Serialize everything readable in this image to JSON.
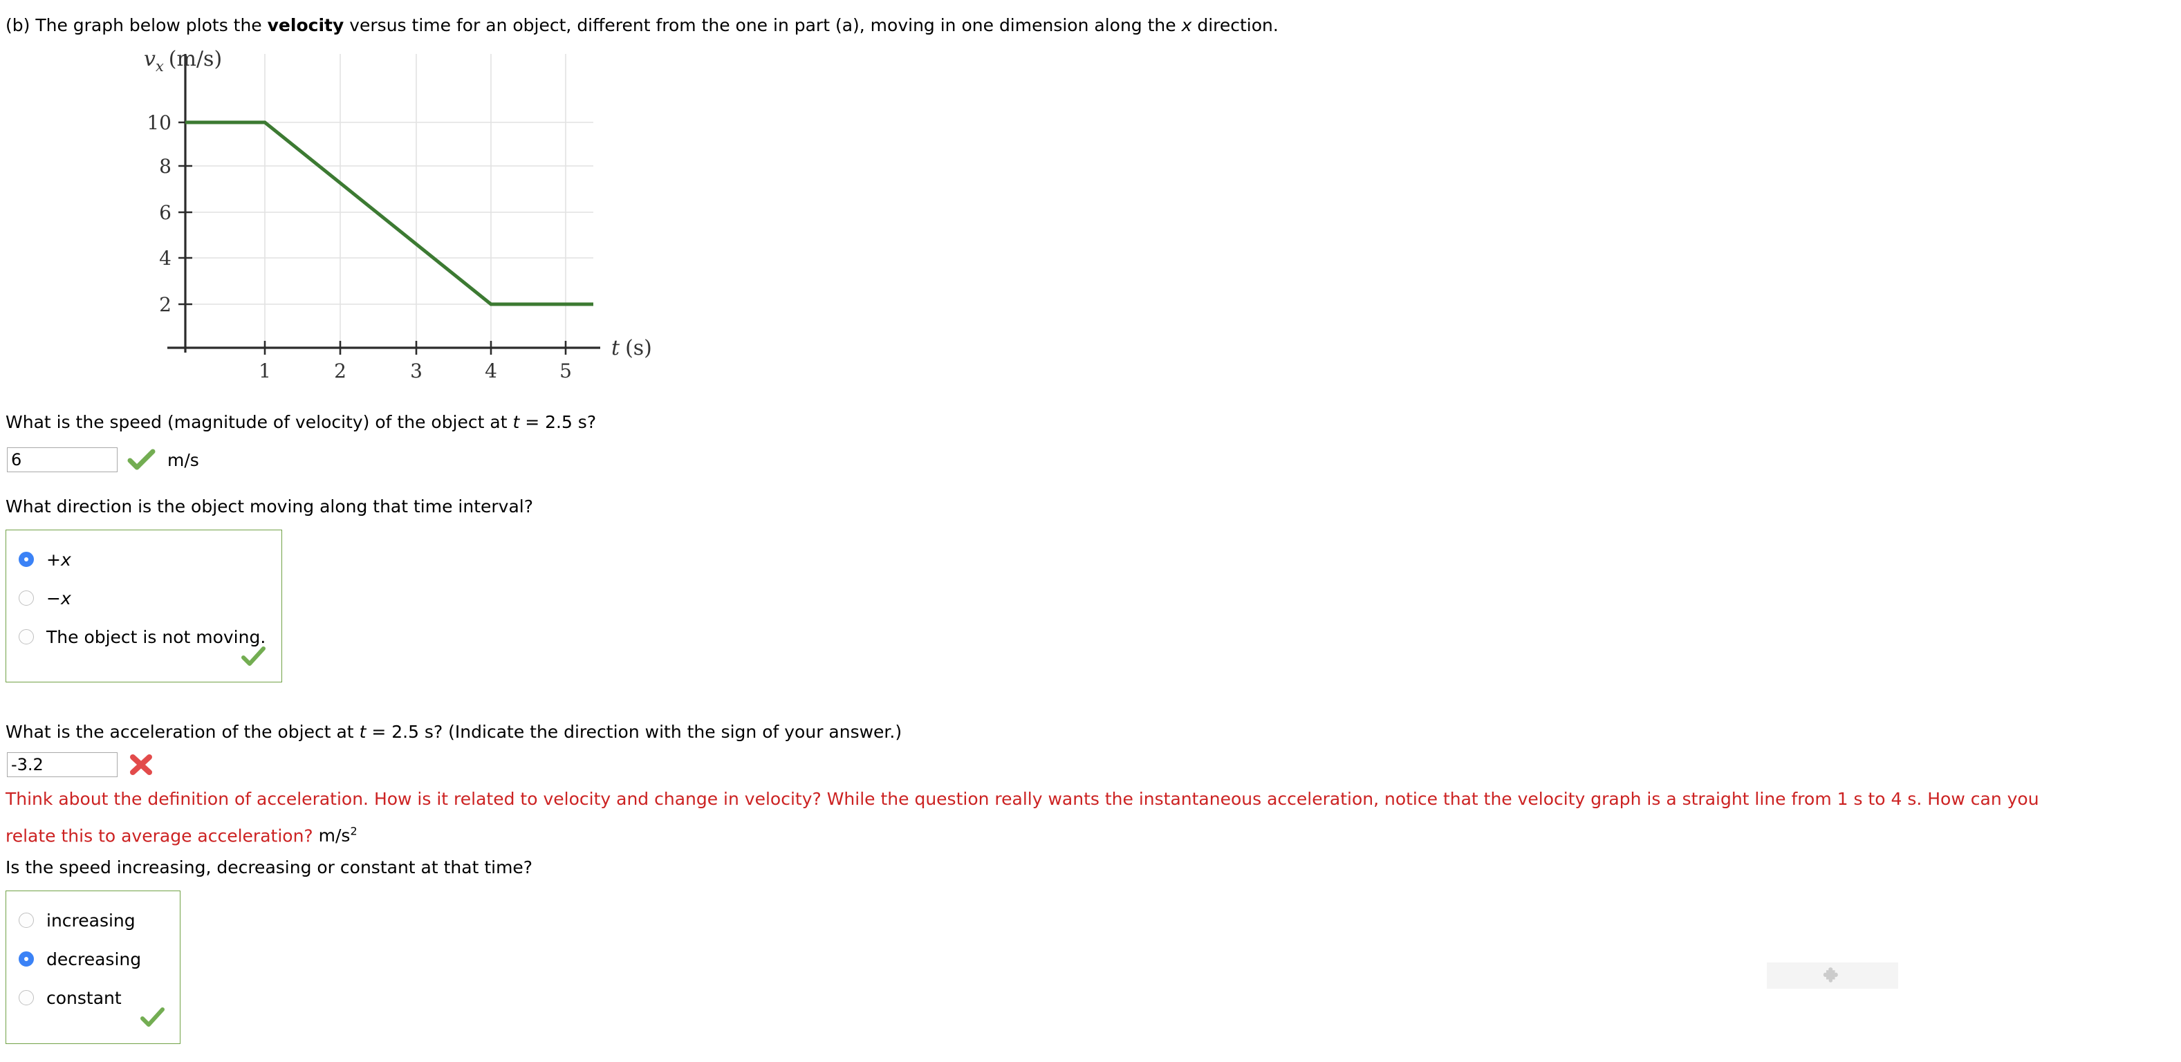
{
  "intro": {
    "prefix": "(b) The graph below plots the ",
    "bold": "velocity",
    "mid": " versus time for an object, different from the one in part (a), moving in one dimension along the ",
    "italic_var": "x",
    "suffix": " direction."
  },
  "chart_data": {
    "type": "line",
    "title": "",
    "xlabel": "t (s)",
    "ylabel": "v_x (m/s)",
    "ylabel_var": "v",
    "ylabel_sub": "x",
    "ylabel_units": "(m/s)",
    "xlabel_var": "t",
    "xlabel_units": "(s)",
    "xlim": [
      0,
      5.6
    ],
    "ylim": [
      0,
      11.2
    ],
    "xticks": [
      1,
      2,
      3,
      4,
      5
    ],
    "xtick_labels": [
      "1",
      "2",
      "3",
      "4",
      "5"
    ],
    "yticks": [
      2,
      4,
      6,
      8,
      10
    ],
    "ytick_labels": [
      "2",
      "4",
      "6",
      "8",
      "10"
    ],
    "grid": true,
    "line_color": "#3c7a32",
    "series": [
      {
        "name": "vx",
        "points": [
          [
            0,
            10
          ],
          [
            1,
            10
          ],
          [
            4,
            2
          ],
          [
            5.2,
            2
          ]
        ]
      }
    ],
    "annotations": []
  },
  "q1": {
    "prompt_a": "What is the speed (magnitude of velocity) of the object at ",
    "prompt_var": "t",
    "prompt_b": " = 2.5 s?",
    "value": "6",
    "placeholder": "",
    "unit": "m/s",
    "status": "correct"
  },
  "q2": {
    "prompt": "What direction is the object moving along that time interval?",
    "options": [
      {
        "label_pre": "+",
        "label_var": "x",
        "label_post": "",
        "selected": true
      },
      {
        "label_pre": "−",
        "label_var": "x",
        "label_post": "",
        "selected": false
      },
      {
        "label_pre": "The object is not moving.",
        "label_var": "",
        "label_post": "",
        "selected": false
      }
    ],
    "status": "correct"
  },
  "q3": {
    "prompt_a": "What is the acceleration of the object at ",
    "prompt_var": "t",
    "prompt_b": " = 2.5 s? (Indicate the direction with the sign of your answer.)",
    "value": "-3.2",
    "placeholder": "",
    "status": "incorrect",
    "feedback_line1": "Think about the definition of acceleration. How is it related to velocity and change in velocity? While the question really wants the instantaneous acceleration, notice that the velocity graph is a straight line from 1 s to 4 s. How can you",
    "feedback_line2": "relate this to average acceleration?",
    "unit_base": "m/s",
    "unit_sup": "2"
  },
  "q4": {
    "prompt": "Is the speed increasing, decreasing or constant at that time?",
    "options": [
      {
        "label_pre": "increasing",
        "label_var": "",
        "label_post": "",
        "selected": false
      },
      {
        "label_pre": "decreasing",
        "label_var": "",
        "label_post": "",
        "selected": true
      },
      {
        "label_pre": "constant",
        "label_var": "",
        "label_post": "",
        "selected": false
      }
    ],
    "status": "correct"
  },
  "plugin": {
    "icon": "puzzle-piece-icon"
  },
  "colors": {
    "correct_green": "#71a246",
    "incorrect_red": "#cc2222",
    "radio_blue": "#3b82f6",
    "graph_green": "#3c7a32"
  }
}
